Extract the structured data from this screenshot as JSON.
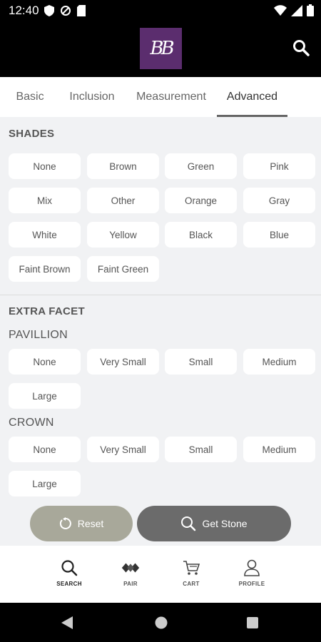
{
  "status_bar": {
    "time": "12:40"
  },
  "app": {
    "logo_text": "BB"
  },
  "tabs": [
    {
      "label": "Basic"
    },
    {
      "label": "Inclusion"
    },
    {
      "label": "Measurement"
    },
    {
      "label": "Advanced"
    }
  ],
  "active_tab": "Advanced",
  "shades": {
    "title": "SHADES",
    "options": [
      "None",
      "Brown",
      "Green",
      "Pink",
      "Mix",
      "Other",
      "Orange",
      "Gray",
      "White",
      "Yellow",
      "Black",
      "Blue",
      "Faint Brown",
      "Faint Green"
    ]
  },
  "extra_facet": {
    "title": "EXTRA FACET",
    "pavillion": {
      "label": "PAVILLION",
      "options": [
        "None",
        "Very Small",
        "Small",
        "Medium",
        "Large"
      ]
    },
    "crown": {
      "label": "CROWN",
      "options": [
        "None",
        "Very Small",
        "Small",
        "Medium",
        "Large"
      ]
    }
  },
  "actions": {
    "reset_label": "Reset",
    "get_stone_label": "Get Stone"
  },
  "bottom_nav": [
    {
      "label": "SEARCH",
      "icon": "search-icon"
    },
    {
      "label": "PAIR",
      "icon": "pair-icon"
    },
    {
      "label": "CART",
      "icon": "cart-icon"
    },
    {
      "label": "PROFILE",
      "icon": "profile-icon"
    }
  ],
  "colors": {
    "brand": "#5b2d6e",
    "reset_button": "#a8a89a",
    "get_stone_button": "#6b6b6b",
    "background": "#f1f2f4"
  }
}
